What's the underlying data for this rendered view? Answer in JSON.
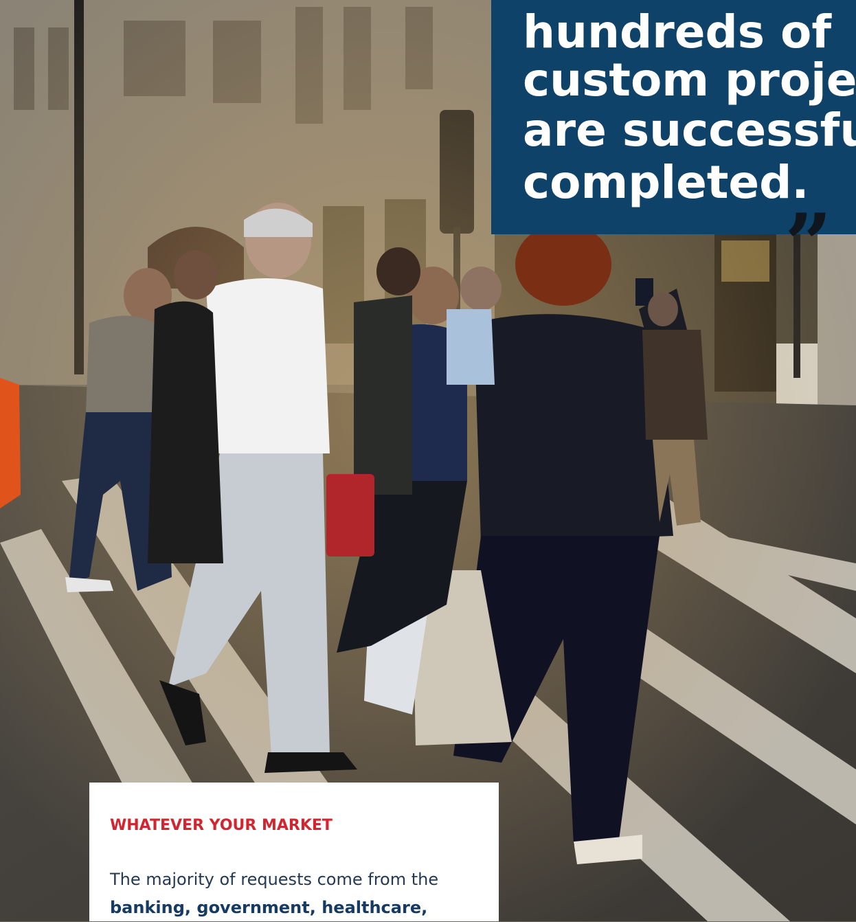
{
  "quote": {
    "lines": [
      "hundreds of",
      "custom projects",
      "are successfully",
      "completed."
    ],
    "close_mark": "”"
  },
  "market": {
    "heading": "WHATEVER YOUR MARKET",
    "text_prefix": "The majority of requests come from the ",
    "text_bold": "banking, government, healthcare,"
  },
  "colors": {
    "quote_panel": "#0e4268",
    "heading_accent": "#d3252f"
  }
}
